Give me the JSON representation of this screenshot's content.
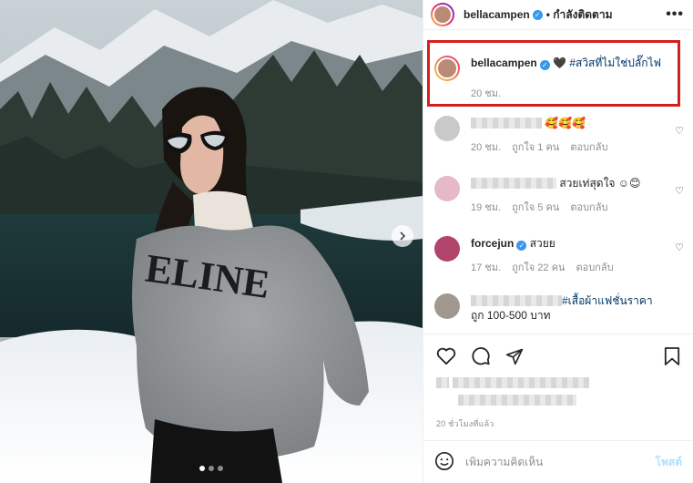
{
  "header": {
    "username": "bellacampen",
    "follow_status": "• กำลังติดตาม",
    "more_icon": "more-icon"
  },
  "caption": {
    "username": "bellacampen",
    "text": "🖤 #สวิสที่ไม่ใช่ปลั๊กไฟ",
    "time": "20 ชม."
  },
  "comments": [
    {
      "text": "🥰🥰🥰",
      "time": "20 ชม.",
      "likes": "ถูกใจ 1 คน",
      "reply": "ตอบกลับ",
      "avatar_color": "#c9c9c9"
    },
    {
      "text": "สวยเท่สุดใจ ☺😊",
      "time": "19 ชม.",
      "likes": "ถูกใจ 5 คน",
      "reply": "ตอบกลับ",
      "avatar_color": "#e6b9c6"
    },
    {
      "username": "forcejun",
      "text": "สวยย",
      "time": "17 ชม.",
      "likes": "ถูกใจ 22 คน",
      "reply": "ตอบกลับ",
      "avatar_color": "#b0446a"
    },
    {
      "hashtag": "#เสื้อผ้าแฟชั่นราคา",
      "second_line": "ถูก 100-500 บาท",
      "avatar_color": "#a0988e"
    }
  ],
  "actions": {
    "like_icon": "heart-icon",
    "comment_icon": "comment-icon",
    "share_icon": "share-icon",
    "save_icon": "bookmark-icon"
  },
  "post_time": "20 ชั่วโมงที่แล้ว",
  "comment_input": {
    "placeholder": "เพิ่มความคิดเห็น",
    "post_label": "โพสต์"
  },
  "carousel": {
    "total": 3,
    "active": 1
  },
  "colors": {
    "verified": "#3897f0",
    "highlight": "#d41f1f",
    "hashtag": "#00376b",
    "post_disabled": "#b2dffc"
  }
}
